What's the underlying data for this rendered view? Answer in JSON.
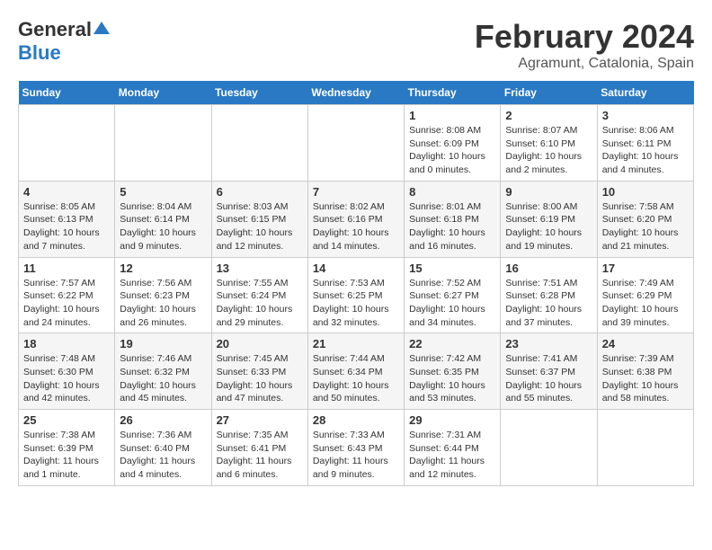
{
  "logo": {
    "general": "General",
    "blue": "Blue"
  },
  "header": {
    "month": "February 2024",
    "location": "Agramunt, Catalonia, Spain"
  },
  "weekdays": [
    "Sunday",
    "Monday",
    "Tuesday",
    "Wednesday",
    "Thursday",
    "Friday",
    "Saturday"
  ],
  "weeks": [
    [
      {
        "day": "",
        "info": ""
      },
      {
        "day": "",
        "info": ""
      },
      {
        "day": "",
        "info": ""
      },
      {
        "day": "",
        "info": ""
      },
      {
        "day": "1",
        "info": "Sunrise: 8:08 AM\nSunset: 6:09 PM\nDaylight: 10 hours\nand 0 minutes."
      },
      {
        "day": "2",
        "info": "Sunrise: 8:07 AM\nSunset: 6:10 PM\nDaylight: 10 hours\nand 2 minutes."
      },
      {
        "day": "3",
        "info": "Sunrise: 8:06 AM\nSunset: 6:11 PM\nDaylight: 10 hours\nand 4 minutes."
      }
    ],
    [
      {
        "day": "4",
        "info": "Sunrise: 8:05 AM\nSunset: 6:13 PM\nDaylight: 10 hours\nand 7 minutes."
      },
      {
        "day": "5",
        "info": "Sunrise: 8:04 AM\nSunset: 6:14 PM\nDaylight: 10 hours\nand 9 minutes."
      },
      {
        "day": "6",
        "info": "Sunrise: 8:03 AM\nSunset: 6:15 PM\nDaylight: 10 hours\nand 12 minutes."
      },
      {
        "day": "7",
        "info": "Sunrise: 8:02 AM\nSunset: 6:16 PM\nDaylight: 10 hours\nand 14 minutes."
      },
      {
        "day": "8",
        "info": "Sunrise: 8:01 AM\nSunset: 6:18 PM\nDaylight: 10 hours\nand 16 minutes."
      },
      {
        "day": "9",
        "info": "Sunrise: 8:00 AM\nSunset: 6:19 PM\nDaylight: 10 hours\nand 19 minutes."
      },
      {
        "day": "10",
        "info": "Sunrise: 7:58 AM\nSunset: 6:20 PM\nDaylight: 10 hours\nand 21 minutes."
      }
    ],
    [
      {
        "day": "11",
        "info": "Sunrise: 7:57 AM\nSunset: 6:22 PM\nDaylight: 10 hours\nand 24 minutes."
      },
      {
        "day": "12",
        "info": "Sunrise: 7:56 AM\nSunset: 6:23 PM\nDaylight: 10 hours\nand 26 minutes."
      },
      {
        "day": "13",
        "info": "Sunrise: 7:55 AM\nSunset: 6:24 PM\nDaylight: 10 hours\nand 29 minutes."
      },
      {
        "day": "14",
        "info": "Sunrise: 7:53 AM\nSunset: 6:25 PM\nDaylight: 10 hours\nand 32 minutes."
      },
      {
        "day": "15",
        "info": "Sunrise: 7:52 AM\nSunset: 6:27 PM\nDaylight: 10 hours\nand 34 minutes."
      },
      {
        "day": "16",
        "info": "Sunrise: 7:51 AM\nSunset: 6:28 PM\nDaylight: 10 hours\nand 37 minutes."
      },
      {
        "day": "17",
        "info": "Sunrise: 7:49 AM\nSunset: 6:29 PM\nDaylight: 10 hours\nand 39 minutes."
      }
    ],
    [
      {
        "day": "18",
        "info": "Sunrise: 7:48 AM\nSunset: 6:30 PM\nDaylight: 10 hours\nand 42 minutes."
      },
      {
        "day": "19",
        "info": "Sunrise: 7:46 AM\nSunset: 6:32 PM\nDaylight: 10 hours\nand 45 minutes."
      },
      {
        "day": "20",
        "info": "Sunrise: 7:45 AM\nSunset: 6:33 PM\nDaylight: 10 hours\nand 47 minutes."
      },
      {
        "day": "21",
        "info": "Sunrise: 7:44 AM\nSunset: 6:34 PM\nDaylight: 10 hours\nand 50 minutes."
      },
      {
        "day": "22",
        "info": "Sunrise: 7:42 AM\nSunset: 6:35 PM\nDaylight: 10 hours\nand 53 minutes."
      },
      {
        "day": "23",
        "info": "Sunrise: 7:41 AM\nSunset: 6:37 PM\nDaylight: 10 hours\nand 55 minutes."
      },
      {
        "day": "24",
        "info": "Sunrise: 7:39 AM\nSunset: 6:38 PM\nDaylight: 10 hours\nand 58 minutes."
      }
    ],
    [
      {
        "day": "25",
        "info": "Sunrise: 7:38 AM\nSunset: 6:39 PM\nDaylight: 11 hours\nand 1 minute."
      },
      {
        "day": "26",
        "info": "Sunrise: 7:36 AM\nSunset: 6:40 PM\nDaylight: 11 hours\nand 4 minutes."
      },
      {
        "day": "27",
        "info": "Sunrise: 7:35 AM\nSunset: 6:41 PM\nDaylight: 11 hours\nand 6 minutes."
      },
      {
        "day": "28",
        "info": "Sunrise: 7:33 AM\nSunset: 6:43 PM\nDaylight: 11 hours\nand 9 minutes."
      },
      {
        "day": "29",
        "info": "Sunrise: 7:31 AM\nSunset: 6:44 PM\nDaylight: 11 hours\nand 12 minutes."
      },
      {
        "day": "",
        "info": ""
      },
      {
        "day": "",
        "info": ""
      }
    ]
  ]
}
